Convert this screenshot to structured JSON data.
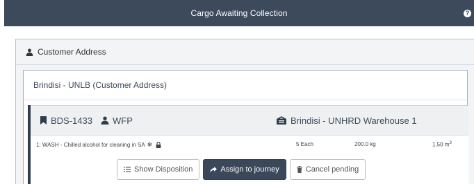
{
  "topbar": {
    "title": "Cargo Awaiting Collection",
    "help_icon": "question-circle-icon"
  },
  "section": {
    "heading": "Customer Address",
    "icon": "user-icon"
  },
  "address_panel": {
    "heading": "Brindisi - UNLB (Customer Address)"
  },
  "consignment": {
    "reference": "BDS-1433",
    "reference_icon": "bookmark-icon",
    "client": "WFP",
    "client_icon": "user-icon",
    "warehouse": "Brindisi - UNHRD Warehouse 1",
    "warehouse_icon": "warehouse-icon",
    "items": [
      {
        "description": "1: WASH - Chilled alcohol for cleaning in SA",
        "flags": [
          "snowflake-icon",
          "lock-icon"
        ],
        "quantity": "5 Each",
        "weight": "200.0 kg",
        "volume": "1.50 m",
        "volume_unit_sup": "3"
      }
    ],
    "actions": {
      "show_disposition": "Show Disposition",
      "assign_to_journey": "Assign to journey",
      "cancel_pending": "Cancel pending"
    }
  },
  "colors": {
    "topbar_bg": "#3c4a5b",
    "primary_button": "#3a4859",
    "panel_border": "#9fb1c4",
    "accent_bar": "#2f3c4c"
  }
}
